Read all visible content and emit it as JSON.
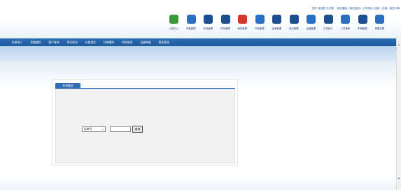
{
  "header": {
    "links": [
      {
        "text": "您好 欢迎您 今天是："
      },
      {
        "text": "  ",
        "warn": true
      },
      {
        "text": "  我的桌面 | 我的信息 | 公共查询 | 回帐 | 注销 | 我的订单"
      }
    ],
    "toolbar": [
      {
        "label": "公告办公",
        "icon": "people-icon",
        "color": "#3a9a3a"
      },
      {
        "label": "采集管理",
        "icon": "disc-icon",
        "color": "#2a6fc1"
      },
      {
        "label": "中标管理",
        "icon": "target-icon",
        "color": "#1d4f8f"
      },
      {
        "label": "中标管理",
        "icon": "power-icon",
        "color": "#1d4f8f"
      },
      {
        "label": "我的管理",
        "icon": "gear-icon",
        "color": "#d43a2a"
      },
      {
        "label": "开采管理",
        "icon": "hat-icon",
        "color": "#2a6fc1"
      },
      {
        "label": "运单管理",
        "icon": "document-icon",
        "color": "#1d4f8f"
      },
      {
        "label": "网点管理",
        "icon": "network-icon",
        "color": "#1d4f8f"
      },
      {
        "label": "运营管理",
        "icon": "monitor-icon",
        "color": "#2a6fc1"
      },
      {
        "label": "汇总统计",
        "icon": "chart-icon",
        "color": "#1d4f8f"
      },
      {
        "label": "三件通单",
        "icon": "globe-icon",
        "color": "#2a6fc1"
      },
      {
        "label": "车辆管理",
        "icon": "truck-icon",
        "color": "#1d4f8f"
      },
      {
        "label": "单据设置",
        "icon": "settings-icon",
        "color": "#2a6fc1"
      }
    ]
  },
  "nav": {
    "items": [
      "托单录入",
      "货物跟踪",
      "客户查询",
      "到付改派",
      "价格设定",
      "托单删除",
      "托单修改",
      "运输单据",
      "报表管理"
    ]
  },
  "panel": {
    "tab_label": "托单删除",
    "select_value": "运单号",
    "search_input": "",
    "search_button": "查询"
  }
}
